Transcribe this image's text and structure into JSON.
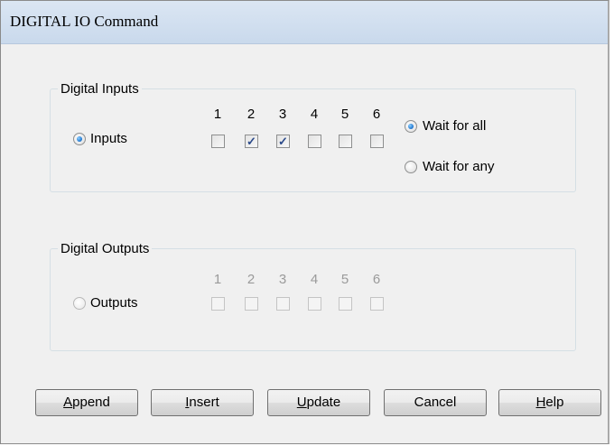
{
  "window": {
    "title": "DIGITAL IO Command"
  },
  "inputs_group": {
    "label": "Digital Inputs",
    "radio_label": "Inputs",
    "radio_selected": true,
    "columns": [
      "1",
      "2",
      "3",
      "4",
      "5",
      "6"
    ],
    "checked": [
      false,
      true,
      true,
      false,
      false,
      false
    ],
    "wait_all_label": "Wait for all",
    "wait_any_label": "Wait for any",
    "wait_mode": "all"
  },
  "outputs_group": {
    "label": "Digital Outputs",
    "radio_label": "Outputs",
    "radio_selected": false,
    "columns": [
      "1",
      "2",
      "3",
      "4",
      "5",
      "6"
    ],
    "checked": [
      false,
      false,
      false,
      false,
      false,
      false
    ],
    "enabled": false
  },
  "buttons": {
    "append": {
      "accel": "A",
      "rest": "ppend"
    },
    "insert": {
      "accel": "I",
      "rest": "nsert"
    },
    "update": {
      "accel": "U",
      "rest": "pdate"
    },
    "cancel": {
      "label": "Cancel"
    },
    "help": {
      "accel": "H",
      "rest": "elp"
    }
  }
}
